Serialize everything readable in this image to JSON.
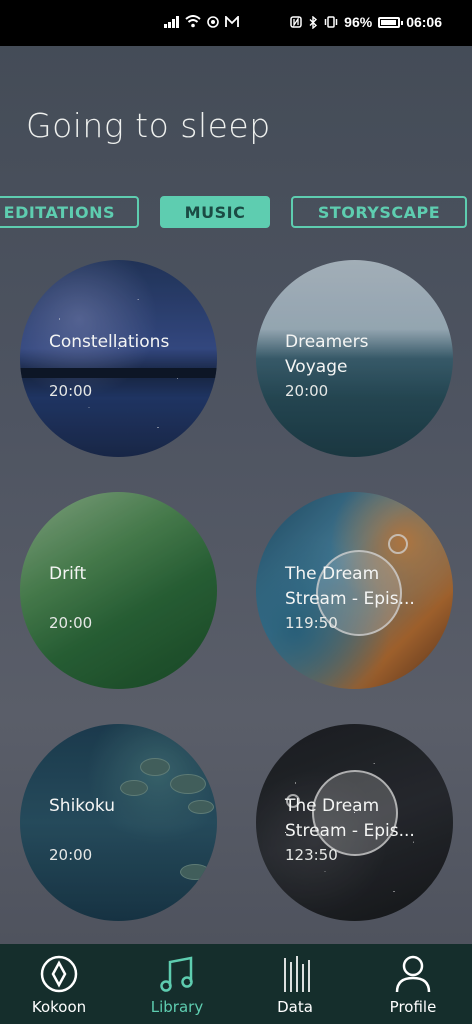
{
  "status_bar": {
    "battery": "96%",
    "time": "06:06"
  },
  "page": {
    "title": "Going to sleep"
  },
  "tabs": [
    {
      "label": "EDITATIONS",
      "active": false
    },
    {
      "label": "MUSIC",
      "active": true
    },
    {
      "label": "STORYSCAPE",
      "active": false
    }
  ],
  "cards": [
    {
      "title": "Constellations",
      "time": "20:00"
    },
    {
      "title": "Dreamers Voyage",
      "time": "20:00"
    },
    {
      "title": "Drift",
      "time": "20:00"
    },
    {
      "title": "The Dream Stream - Epis...",
      "time": "119:50"
    },
    {
      "title": "Shikoku",
      "time": "20:00"
    },
    {
      "title": "The Dream Stream - Epis...",
      "time": "123:50"
    }
  ],
  "bottom_nav": [
    {
      "label": "Kokoon",
      "icon": "kokoon-logo-icon",
      "active": false
    },
    {
      "label": "Library",
      "icon": "music-note-icon",
      "active": true
    },
    {
      "label": "Data",
      "icon": "data-bars-icon",
      "active": false
    },
    {
      "label": "Profile",
      "icon": "profile-icon",
      "active": false
    }
  ],
  "colors": {
    "accent": "#5ecdb0",
    "nav_background": "#152e2c"
  }
}
